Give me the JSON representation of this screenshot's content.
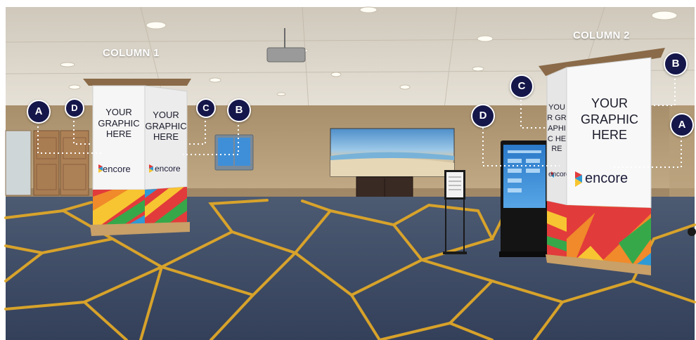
{
  "column1": {
    "title": "COLUMN 1",
    "wrap_left": "YOUR GRAPHIC HERE",
    "wrap_right": "YOUR GRAPHIC HERE",
    "logo_left": "encore",
    "logo_right": "encore",
    "callouts": [
      "A",
      "D",
      "C",
      "B"
    ]
  },
  "column2": {
    "title": "COLUMN 2",
    "wrap_left": "YOUR GRAPHIC HERE",
    "wrap_right": "YOUR GRAPHIC HERE",
    "logo_left": "encore",
    "logo_right": "encore",
    "callouts": [
      "B",
      "C",
      "D",
      "A"
    ]
  },
  "colors": {
    "badge": "#15164a",
    "carpet": "#3a4a64",
    "carpet_pattern": "#e0a828",
    "wall": "#b29a76",
    "ceiling": "#ddd7cb",
    "stripes": [
      "#e23b3b",
      "#f08a2a",
      "#f7c531",
      "#37a84a",
      "#2f9ad5"
    ]
  }
}
